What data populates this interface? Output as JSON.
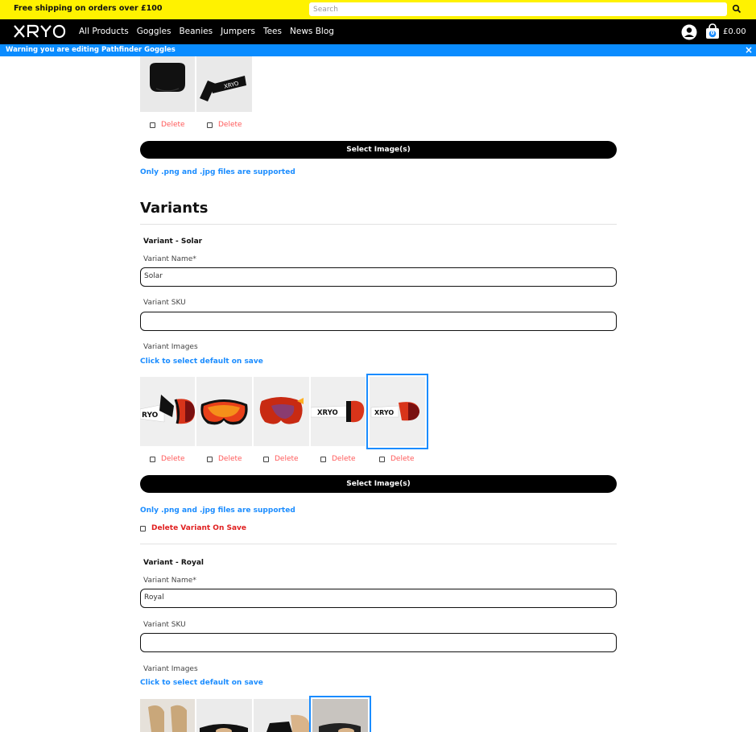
{
  "topbar": {
    "shipping_text": "Free shipping on orders over £100",
    "search_placeholder": "Search"
  },
  "navbar": {
    "logo_text": "XRYO",
    "links": [
      "All Products",
      "Goggles",
      "Beanies",
      "Jumpers",
      "Tees",
      "News Blog"
    ],
    "basket_count": "0",
    "basket_total": "£0.00"
  },
  "warning": {
    "text": "Warning you are editing Pathfinder Goggles",
    "close": "×"
  },
  "product_images": {
    "delete_labels": [
      "Delete",
      "Delete"
    ],
    "select_button": "Select Image(s)",
    "note": "Only .png and .jpg files are supported"
  },
  "variants_heading": "Variants",
  "variants": [
    {
      "title": "Variant - Solar",
      "name_label": "Variant Name*",
      "name_value": "Solar",
      "sku_label": "Variant SKU",
      "sku_value": "",
      "images_label": "Variant Images",
      "default_note": "Click to select default on save",
      "delete_labels": [
        "Delete",
        "Delete",
        "Delete",
        "Delete",
        "Delete"
      ],
      "select_button": "Select Image(s)",
      "file_note": "Only .png and .jpg files are supported",
      "delete_variant": "Delete Variant On Save"
    },
    {
      "title": "Variant - Royal",
      "name_label": "Variant Name*",
      "name_value": "Royal",
      "sku_label": "Variant SKU",
      "sku_value": "",
      "images_label": "Variant Images",
      "default_note": "Click to select default on save"
    }
  ],
  "colors": {
    "topbar": "#fff200",
    "nav": "#000000",
    "warning": "#0a8cff",
    "accent": "#1a8cff",
    "delete": "#ff5a5a"
  }
}
